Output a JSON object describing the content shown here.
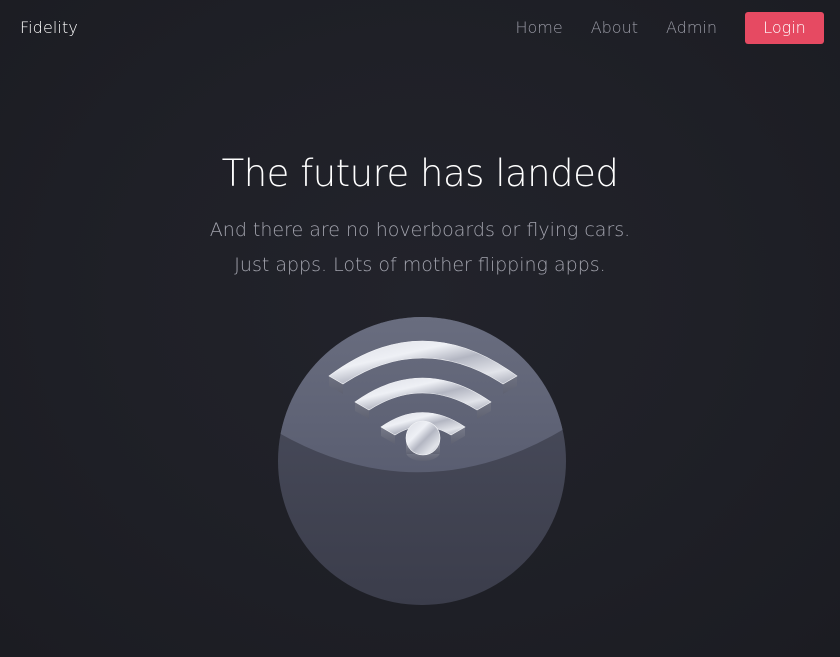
{
  "navbar": {
    "brand": "Fidelity",
    "links": [
      {
        "label": "Home"
      },
      {
        "label": "About"
      },
      {
        "label": "Admin"
      }
    ],
    "login_label": "Login"
  },
  "hero": {
    "title": "The future has landed",
    "subtitle_line1": "And there are no hoverboards or flying cars.",
    "subtitle_line2": "Just apps. Lots of mother flipping apps."
  },
  "illustration": {
    "icon": "wifi-icon"
  },
  "colors": {
    "background": "#1e1f27",
    "accent": "#e64a62",
    "muted_text": "#9a9ba6"
  }
}
